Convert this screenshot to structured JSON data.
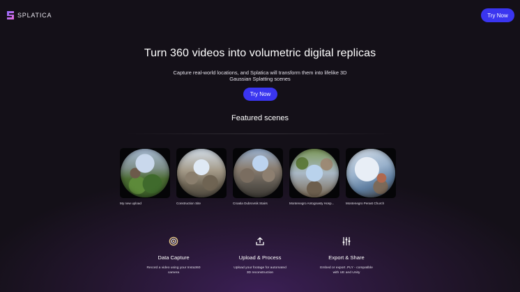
{
  "header": {
    "logo_text": "SPLATICA",
    "cta_label": "Try Now"
  },
  "hero": {
    "title": "Turn 360 videos into volumetric digital replicas",
    "subtitle": "Capture real-world locations, and Splatica will transform them into lifelike 3D Gaussian Splatting scenes",
    "cta_label": "Try Now"
  },
  "featured": {
    "title": "Featured scenes",
    "scenes": [
      {
        "label": "My new upload"
      },
      {
        "label": "Construction Site"
      },
      {
        "label": "Croatia Dubrovnik Stairs"
      },
      {
        "label": "Montenegro Antognasty Hosp..."
      },
      {
        "label": "Montenegro Perast Church"
      }
    ]
  },
  "features": [
    {
      "icon": "target-icon",
      "title": "Data Capture",
      "description": "Record a video using your Insta360 camera"
    },
    {
      "icon": "upload-icon",
      "title": "Upload & Process",
      "description": "Upload your footage for automated 3D reconstruction"
    },
    {
      "icon": "sliders-icon",
      "title": "Export & Share",
      "description": "Embed or export .PLY - compatible with UE and Unity"
    }
  ],
  "colors": {
    "accent": "#3a35f0",
    "background": "#141018",
    "glow": "#3b1f55",
    "icon_gold": "#e6c98a"
  }
}
